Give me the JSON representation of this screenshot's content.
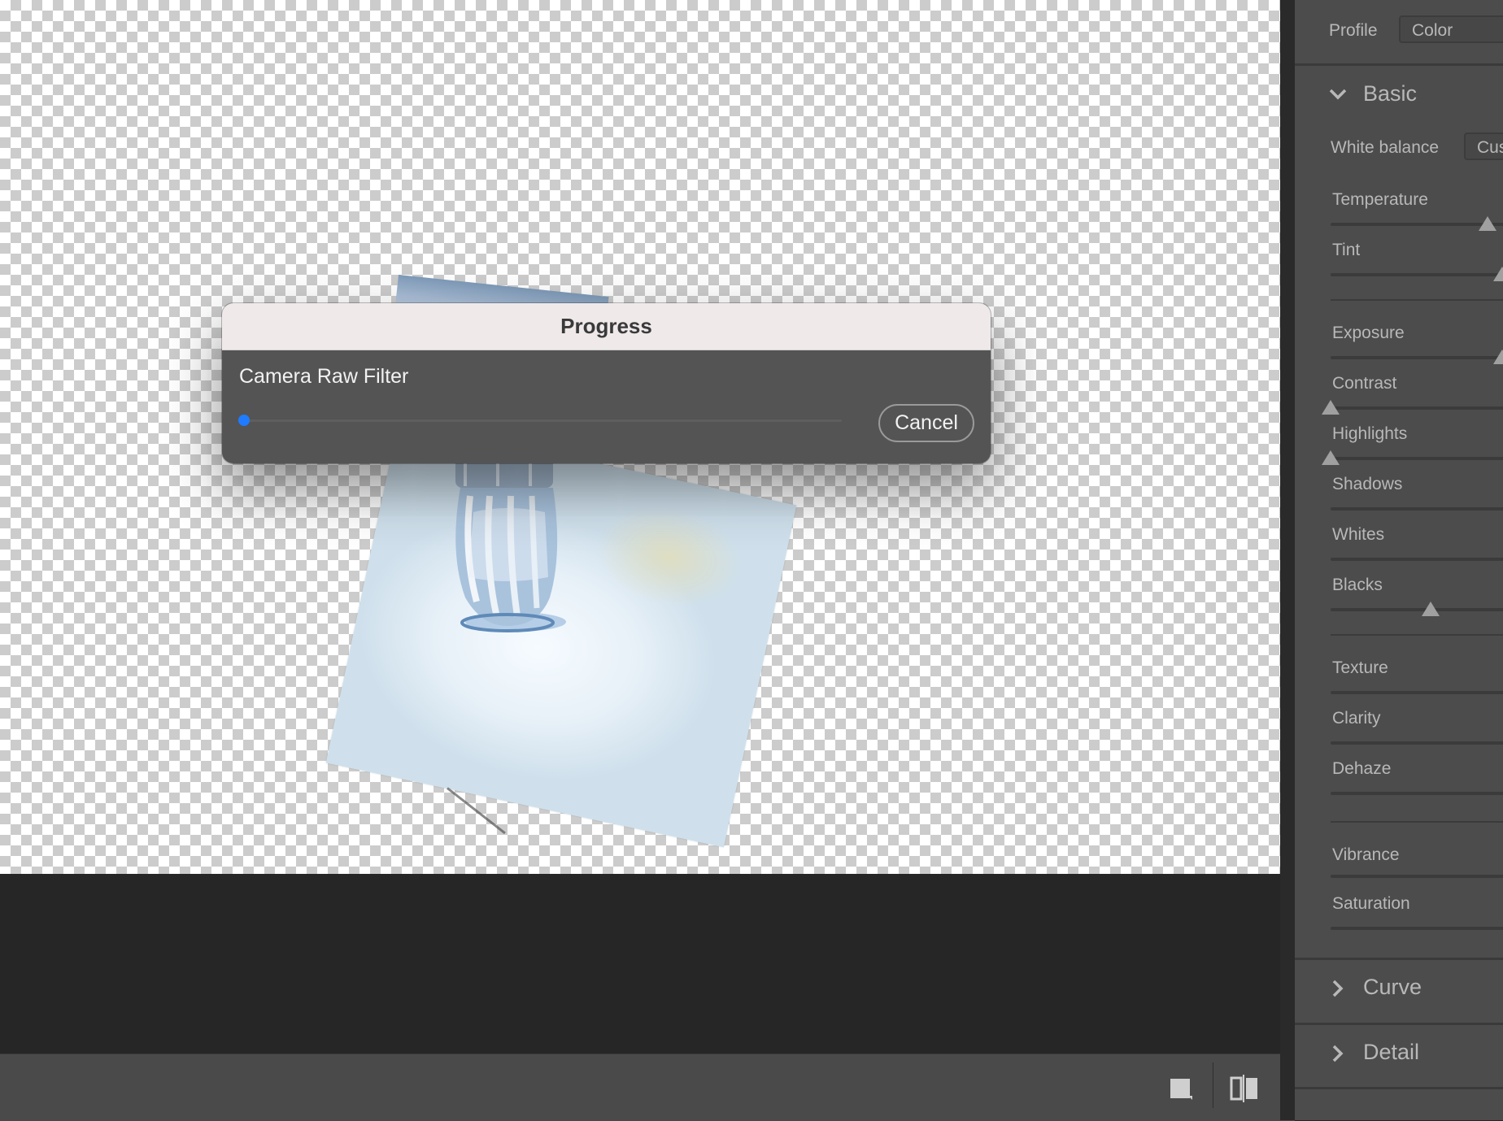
{
  "dialog": {
    "title": "Progress",
    "message": "Camera Raw Filter",
    "progress_percent": 1,
    "cancel_label": "Cancel",
    "accent_color": "#1f7bff"
  },
  "panel": {
    "profile_label": "Profile",
    "profile_value": "Color",
    "basic": {
      "title": "Basic",
      "expanded": true,
      "white_balance_label": "White balance",
      "white_balance_value": "Cus",
      "sliders": [
        {
          "label": "Temperature"
        },
        {
          "label": "Tint"
        },
        {
          "label": "Exposure"
        },
        {
          "label": "Contrast"
        },
        {
          "label": "Highlights"
        },
        {
          "label": "Shadows"
        },
        {
          "label": "Whites"
        },
        {
          "label": "Blacks"
        },
        {
          "label": "Texture"
        },
        {
          "label": "Clarity"
        },
        {
          "label": "Dehaze"
        },
        {
          "label": "Vibrance"
        },
        {
          "label": "Saturation"
        }
      ]
    },
    "sections": [
      {
        "title": "Curve",
        "expanded": false
      },
      {
        "title": "Detail",
        "expanded": false
      }
    ]
  },
  "status_bar": {
    "icons": [
      "single-view-icon",
      "split-view-icon"
    ]
  }
}
